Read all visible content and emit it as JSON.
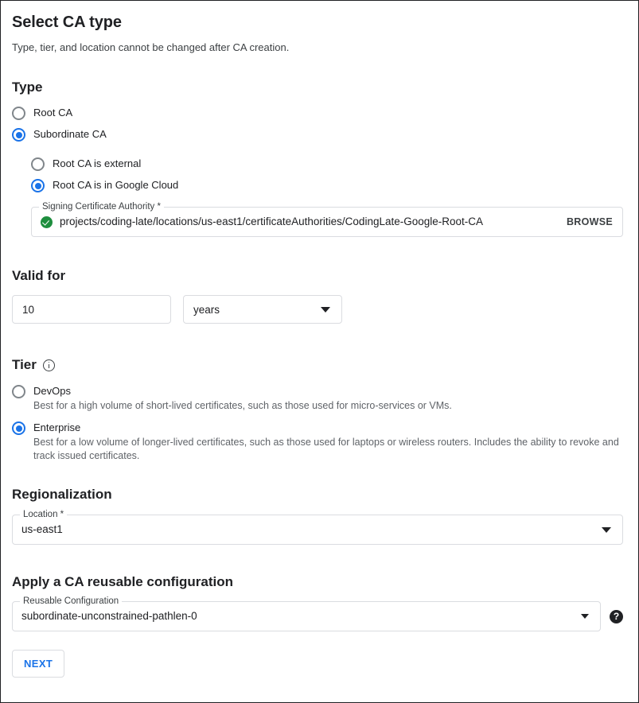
{
  "header": {
    "title": "Select CA type",
    "subtitle": "Type, tier, and location cannot be changed after CA creation."
  },
  "type_section": {
    "title": "Type",
    "options": [
      {
        "label": "Root CA",
        "selected": false
      },
      {
        "label": "Subordinate CA",
        "selected": true
      }
    ],
    "sub_options": [
      {
        "label": "Root CA is external",
        "selected": false
      },
      {
        "label": "Root CA is in Google Cloud",
        "selected": true
      }
    ],
    "signing_ca": {
      "label": "Signing Certificate Authority *",
      "value": "projects/coding-late/locations/us-east1/certificateAuthorities/CodingLate-Google-Root-CA",
      "browse_label": "BROWSE",
      "status_icon": "check-circle-icon"
    }
  },
  "valid_for": {
    "title": "Valid for",
    "amount": "10",
    "unit": "years"
  },
  "tier": {
    "title": "Tier",
    "info_icon": "info-icon",
    "options": [
      {
        "label": "DevOps",
        "description": "Best for a high volume of short-lived certificates, such as those used for micro-services or VMs.",
        "selected": false
      },
      {
        "label": "Enterprise",
        "description": "Best for a low volume of longer-lived certificates, such as those used for laptops or wireless routers. Includes the ability to revoke and track issued certificates.",
        "selected": true
      }
    ]
  },
  "regionalization": {
    "title": "Regionalization",
    "location": {
      "label": "Location *",
      "value": "us-east1"
    }
  },
  "reusable_config": {
    "title": "Apply a CA reusable configuration",
    "field": {
      "label": "Reusable Configuration",
      "value": "subordinate-unconstrained-pathlen-0"
    },
    "help_icon_label": "?"
  },
  "footer": {
    "next_label": "NEXT"
  },
  "colors": {
    "accent": "#1a73e8",
    "success": "#1e8e3e",
    "border": "#dadce0",
    "text": "#202124",
    "muted": "#5f6368"
  }
}
